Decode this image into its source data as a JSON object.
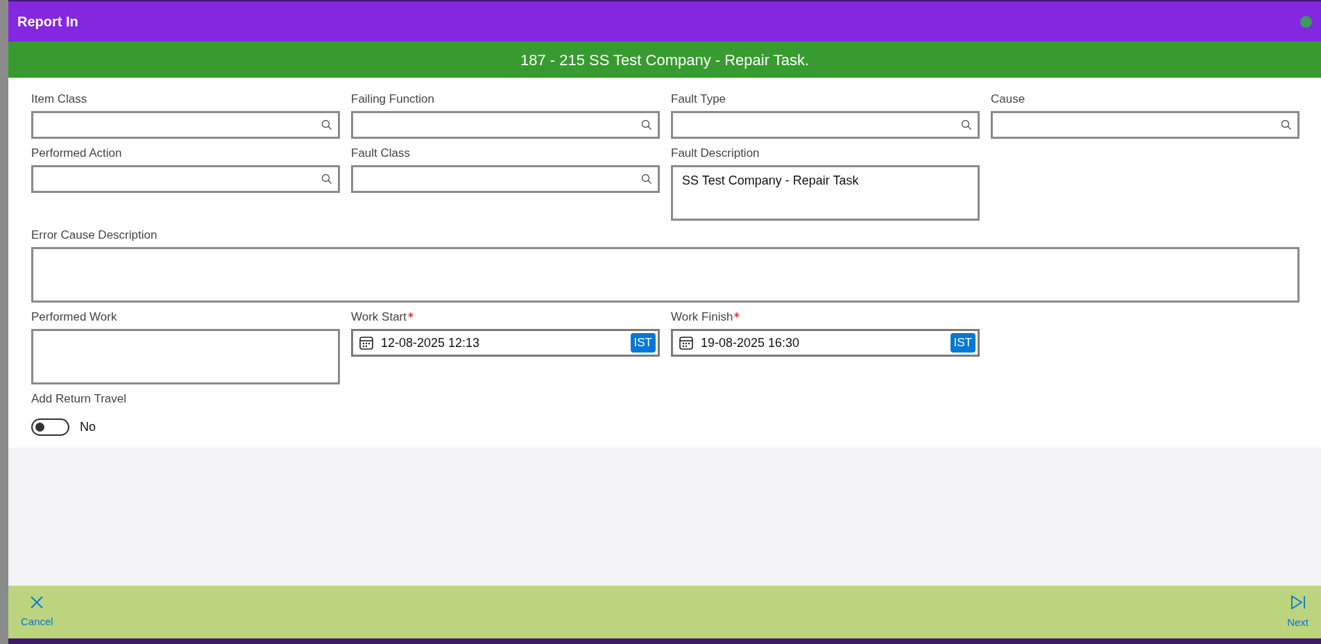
{
  "dialog": {
    "title": "Report In"
  },
  "banner": {
    "text": "187 - 215 SS Test Company - Repair Task."
  },
  "form_rows": [
    [
      {
        "kind": "lookup",
        "label": "Item Class"
      },
      {
        "kind": "lookup",
        "label": "Failing Function"
      },
      {
        "kind": "lookup",
        "label": "Fault Type"
      },
      {
        "kind": "lookup",
        "label": "Cause"
      }
    ],
    [
      {
        "kind": "lookup",
        "label": "Performed Action"
      },
      {
        "kind": "lookup",
        "label": "Fault Class"
      },
      {
        "kind": "textarea",
        "label": "Fault Description",
        "value": "SS Test Company - Repair Task"
      }
    ],
    [
      {
        "kind": "textarea",
        "label": "Error Cause Description"
      }
    ],
    [
      {
        "kind": "textarea",
        "label": "Performed Work"
      },
      {
        "kind": "datetime",
        "label": "Work Start",
        "required": true,
        "value": "12-08-2025 12:13",
        "timezone": "IST"
      },
      {
        "kind": "datetime",
        "label": "Work Finish",
        "required": true,
        "value": "19-08-2025 16:30",
        "timezone": "IST"
      }
    ],
    [
      {
        "kind": "toggle",
        "label": "Add Return Travel",
        "on": false,
        "value_label": "No"
      }
    ]
  ],
  "footer": {
    "buttons": [
      {
        "kind": "cancel",
        "label": "Cancel"
      },
      {
        "kind": "next",
        "label": "Next"
      }
    ]
  }
}
